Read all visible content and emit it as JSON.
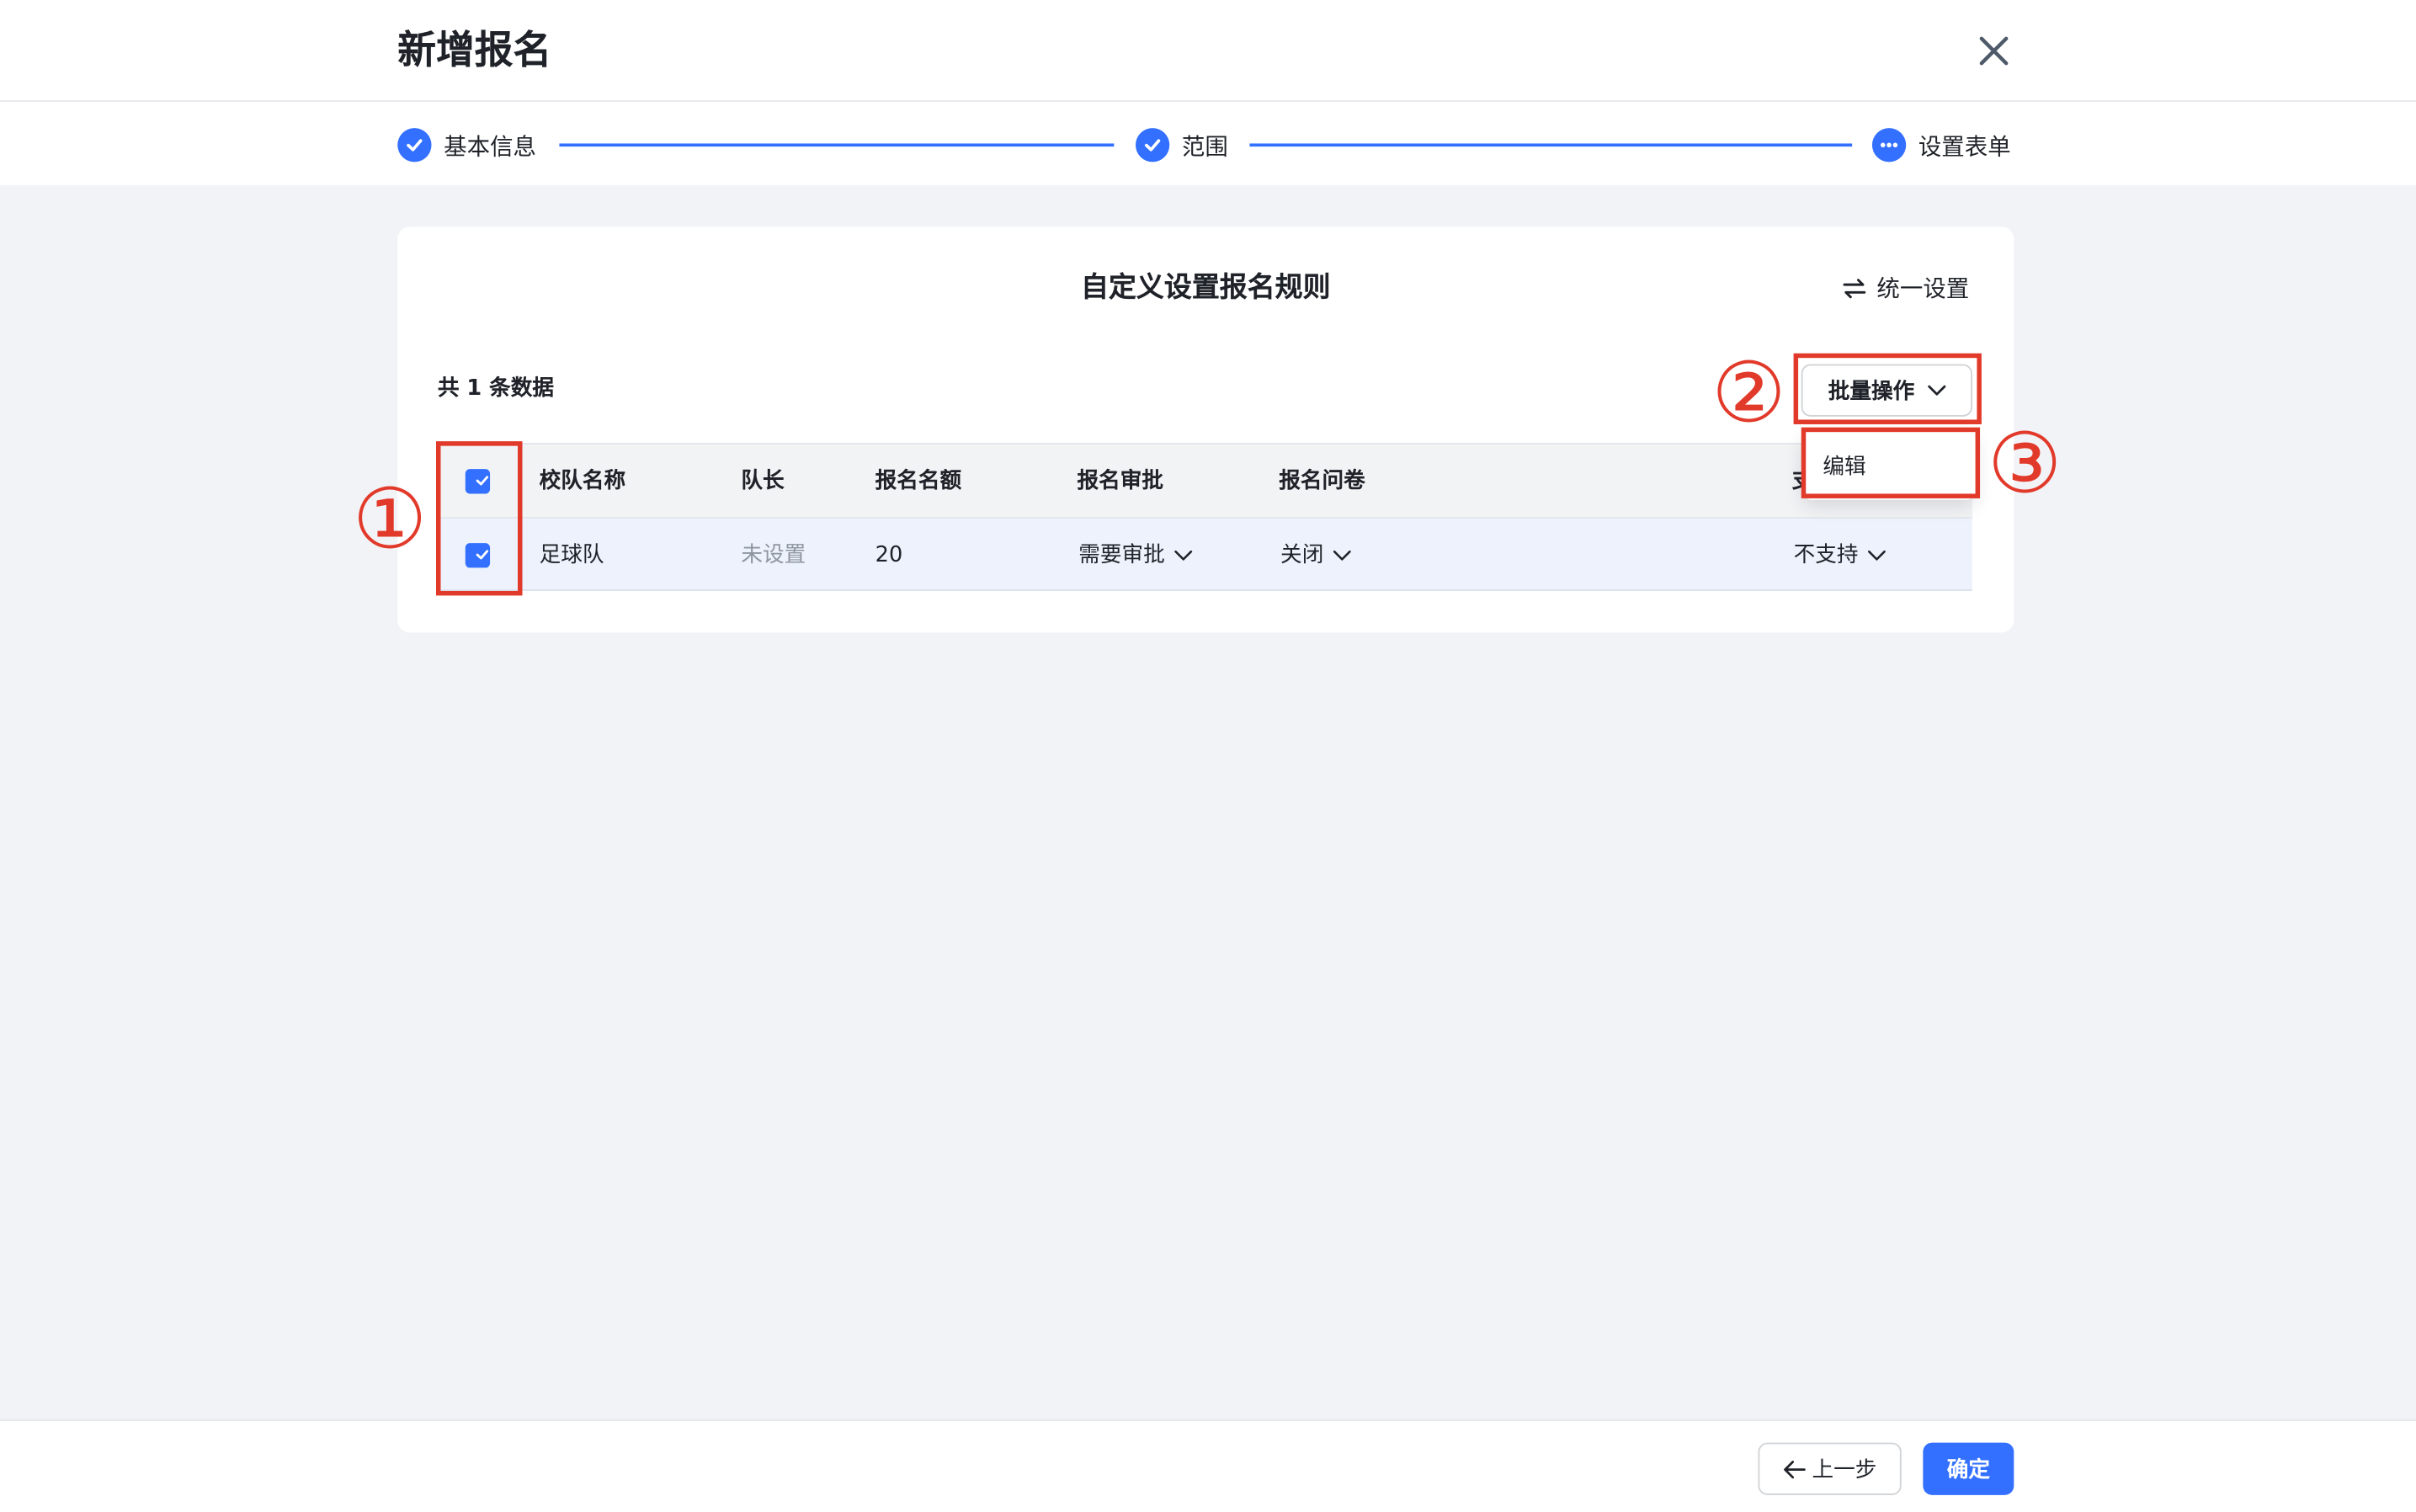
{
  "header": {
    "title": "新增报名"
  },
  "steps": [
    {
      "label": "基本信息",
      "status": "done"
    },
    {
      "label": "范围",
      "status": "done"
    },
    {
      "label": "设置表单",
      "status": "current"
    }
  ],
  "card": {
    "title": "自定义设置报名规则",
    "unify_label": "统一设置",
    "count_text": "共 1 条数据",
    "batch_label": "批量操作"
  },
  "table": {
    "columns": [
      "校队名称",
      "队长",
      "报名名额",
      "报名审批",
      "报名问卷",
      "支"
    ],
    "rows": [
      {
        "checked": true,
        "name": "足球队",
        "captain": "未设置",
        "quota": "20",
        "approval": "需要审批",
        "questionnaire": "关闭",
        "support": "不支持"
      }
    ],
    "header_checked": true
  },
  "dropdown": {
    "items": [
      "编辑"
    ]
  },
  "annotations": [
    "①",
    "②",
    "③"
  ],
  "footer": {
    "prev_label": "上一步",
    "ok_label": "确定"
  },
  "colors": {
    "primary": "#3370ff",
    "annotation_red": "#e23a2a",
    "row_selected": "#edf2fc"
  },
  "icons": [
    "close-icon",
    "check-icon",
    "more-icon",
    "swap-icon",
    "chevron-down-icon",
    "arrow-left-icon"
  ]
}
